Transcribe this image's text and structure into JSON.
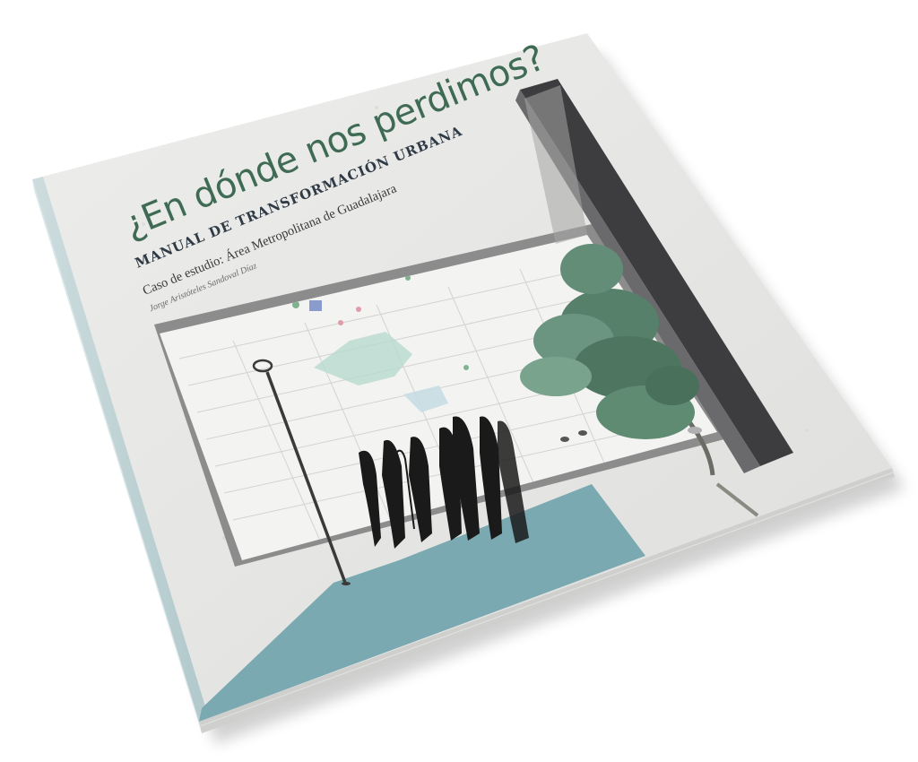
{
  "book": {
    "title": "¿En dónde nos perdimos?",
    "subtitle": "MANUAL DE TRANSFORMACIÓN URBANA",
    "case_study": "Caso de estudio: Área Metropolitana de Guadalajara",
    "author": "Jorge Aristóteles Sandoval Díaz"
  },
  "colors": {
    "cover_bg": "#e6e6e4",
    "title_text": "#3f6b54",
    "subtitle_text": "#2f3a45",
    "body_text": "#3a3a3a",
    "author_text": "#6a6a6a",
    "teal_floor": "#7aa9b1",
    "dark_wall": "#3d3d3f",
    "frame_shadow": "#9a9a9a",
    "tree_green": "#56806a",
    "figures": "#1a1a1a"
  },
  "icons": [
    "lamp-post-icon",
    "tree-icon",
    "people-figures-icon",
    "bird-icon",
    "map-icon"
  ]
}
